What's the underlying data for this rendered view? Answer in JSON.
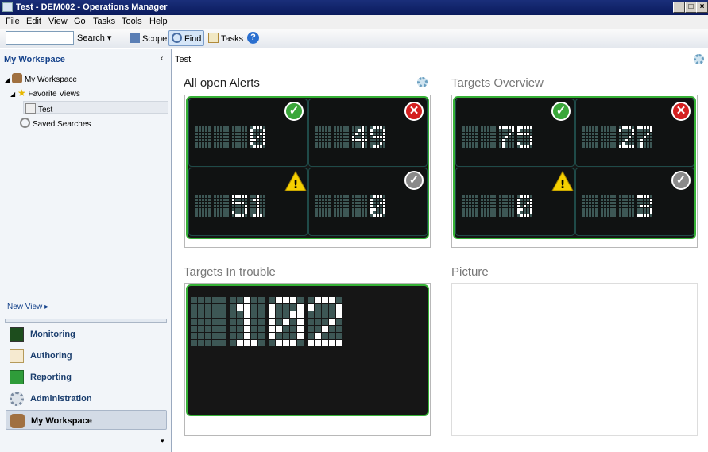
{
  "window": {
    "title": "Test - DEM002 - Operations Manager"
  },
  "menu": [
    "File",
    "Edit",
    "View",
    "Go",
    "Tasks",
    "Tools",
    "Help"
  ],
  "toolbar": {
    "search_value": "",
    "search_label": "Search",
    "scope_label": "Scope",
    "find_label": "Find",
    "tasks_label": "Tasks"
  },
  "sidebar": {
    "header": "My Workspace",
    "tree": [
      {
        "label": "My Workspace"
      },
      {
        "label": "Favorite Views"
      },
      {
        "label": "Test"
      },
      {
        "label": "Saved Searches"
      }
    ],
    "new_view": "New View",
    "wunderbar": [
      {
        "label": "Monitoring",
        "icon": "monitoring-icon"
      },
      {
        "label": "Authoring",
        "icon": "authoring-icon"
      },
      {
        "label": "Reporting",
        "icon": "reporting-icon"
      },
      {
        "label": "Administration",
        "icon": "administration-icon"
      },
      {
        "label": "My Workspace",
        "icon": "my-workspace-icon",
        "selected": true
      }
    ]
  },
  "main": {
    "breadcrumb": "Test",
    "panels": {
      "alerts": {
        "title": "All open Alerts",
        "values": [
          "0",
          "49",
          "51",
          "0"
        ],
        "badges": [
          "ok",
          "err",
          "warn",
          "gray"
        ]
      },
      "targets": {
        "title": "Targets Overview",
        "values": [
          "75",
          "27",
          "0",
          "3"
        ],
        "badges": [
          "ok",
          "err",
          "warn",
          "gray"
        ]
      },
      "trouble": {
        "title": "Targets In trouble",
        "value": "102"
      },
      "picture": {
        "title": "Picture"
      }
    }
  },
  "colors": {
    "board_border": "#36b136",
    "led_on": "#ffffff",
    "led_off": "#3d5755",
    "ok": "#3aa63a",
    "error": "#d42020",
    "warning": "#f5d000",
    "title_bar": "#0a1a5c"
  }
}
